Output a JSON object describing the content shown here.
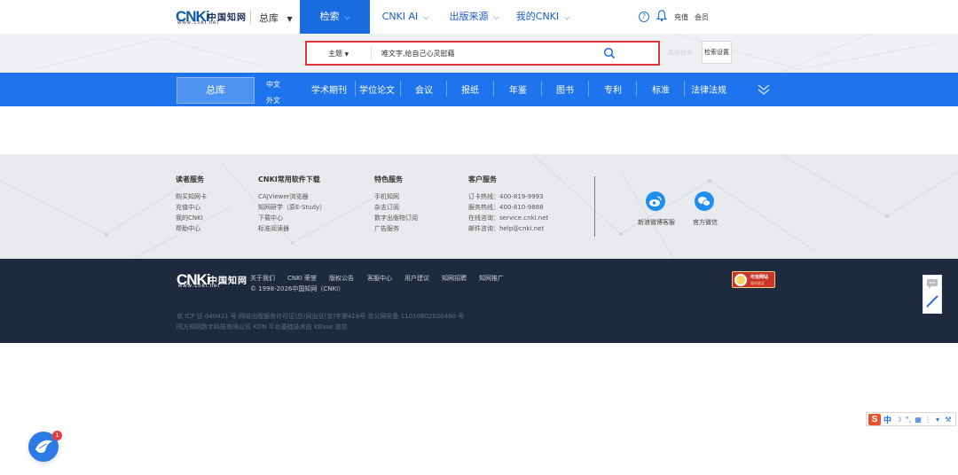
{
  "topnav": {
    "logo": {
      "mark": "CNKi",
      "cn": "中国知网",
      "url": "www.cnki.net"
    },
    "library_selector": "总库",
    "items": [
      {
        "label": "检索",
        "active": true
      },
      {
        "label": "CNKI AI",
        "active": false
      },
      {
        "label": "出版来源",
        "active": false
      },
      {
        "label": "我的CNKI",
        "active": false
      }
    ],
    "help_glyph": "?",
    "recharge": "充值",
    "member": "会员"
  },
  "search": {
    "scope": "主题",
    "query": "唯文字,给自己心灵慰藉",
    "advanced_ghost": "高级检索",
    "settings": "检索设置"
  },
  "categories": {
    "all": "总库",
    "lang_cn": "中文",
    "lang_foreign": "外文",
    "items": [
      "学术期刊",
      "学位论文",
      "会议",
      "报纸",
      "年鉴",
      "图书",
      "专利",
      "标准",
      "法律法规"
    ]
  },
  "footer": {
    "columns": [
      {
        "title": "读者服务",
        "links": [
          "购买知网卡",
          "充值中心",
          "我的CNKI",
          "帮助中心"
        ]
      },
      {
        "title": "CNKI常用软件下载",
        "links": [
          "CAJViewer浏览器",
          "知网研学（原E-Study）",
          "下载中心",
          "标准阅读器"
        ]
      },
      {
        "title": "特色服务",
        "links": [
          "手机知网",
          "杂志订阅",
          "数字出版物订阅",
          "广告服务"
        ]
      },
      {
        "title": "客户服务",
        "links": [
          "订卡热线：400-819-9993",
          "服务热线：400-810-9888",
          "在线咨询：service.cnki.net",
          "邮件咨询：help@cnki.net"
        ]
      }
    ],
    "social": [
      {
        "label": "新浪微博客服",
        "icon": "weibo-icon"
      },
      {
        "label": "官方微信",
        "icon": "wechat-icon"
      }
    ]
  },
  "footer_dark": {
    "links": [
      "关于我们",
      "CNKI 荣誉",
      "版权公告",
      "客服中心",
      "用户建议",
      "知网招聘",
      "知网推广"
    ],
    "copyright": "© 1998-2026中国知网（CNKI）",
    "legal_lines": [
      "京 ICP 证 040431 号  网络出版服务许可证(总)网出证(京)字第416号  京公网安备 11010802020460 号",
      "同方知网数字科技有限公司  KDN 平台基础技术由 KBase 提供."
    ],
    "trust_badge": {
      "line1": "可信网站",
      "line2": "身份验证"
    }
  },
  "ime": {
    "logo": "S",
    "lang": "中"
  },
  "assistant": {
    "badge": "1"
  },
  "colors": {
    "primary": "#1d74ec",
    "nav_active": "#1a6be0",
    "footer_dark": "#1f2a3e",
    "footer_light": "#e9eaed",
    "highlight_border": "#e0363a"
  }
}
